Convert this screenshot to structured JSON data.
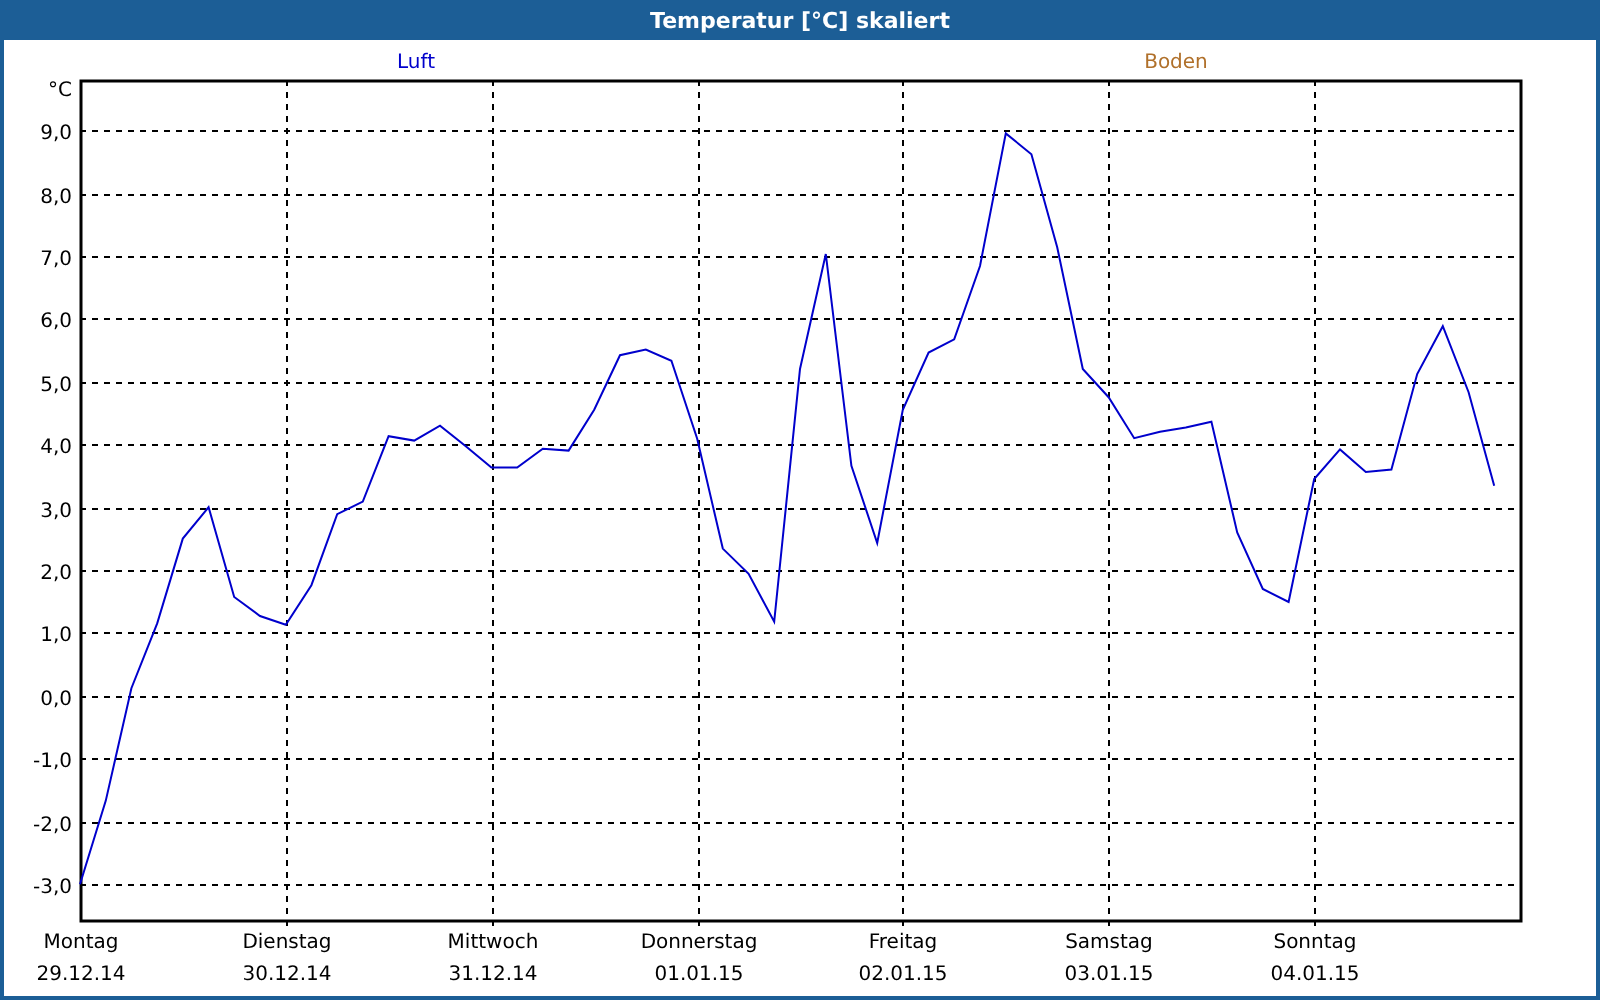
{
  "chart": {
    "extra_legend": [
      {
        "label": "Boden",
        "color": "#b0702a"
      }
    ],
    "dates": [
      "29.12.14",
      "30.12.14",
      "31.12.14",
      "01.01.15",
      "02.01.15",
      "03.01.15",
      "04.01.15"
    ],
    "chart_data": {
      "type": "line",
      "title": "Temperatur [°C] skaliert",
      "ylabel": "°C",
      "grid": true,
      "ylim": [
        -3.57,
        9.8
      ],
      "yticks": [
        {
          "value": 9,
          "label": "9,0"
        },
        {
          "value": 8,
          "label": "8,0"
        },
        {
          "value": 7,
          "label": "7,0"
        },
        {
          "value": 6,
          "label": "6,0"
        },
        {
          "value": 5,
          "label": "5,0"
        },
        {
          "value": 4,
          "label": "4,0"
        },
        {
          "value": 3,
          "label": "3,0"
        },
        {
          "value": 2,
          "label": "2,0"
        },
        {
          "value": 1,
          "label": "1,0"
        },
        {
          "value": 0,
          "label": "0,0"
        },
        {
          "value": -1,
          "label": "-1,0"
        },
        {
          "value": -2,
          "label": "-2,0"
        },
        {
          "value": -3,
          "label": "-3,0"
        }
      ],
      "categories": [
        "Montag",
        null,
        null,
        null,
        null,
        null,
        null,
        null,
        "Dienstag",
        null,
        null,
        null,
        null,
        null,
        null,
        null,
        "Mittwoch",
        null,
        null,
        null,
        null,
        null,
        null,
        null,
        "Donnerstag",
        null,
        null,
        null,
        null,
        null,
        null,
        null,
        "Freitag",
        null,
        null,
        null,
        null,
        null,
        null,
        null,
        "Samstag",
        null,
        null,
        null,
        null,
        null,
        null,
        null,
        "Sonntag",
        null,
        null,
        null,
        null,
        null,
        null,
        null
      ],
      "series": [
        {
          "name": "Luft",
          "color": "#0000cc",
          "values": [
            -3,
            -1.67,
            0.12,
            1.15,
            2.5,
            3.0,
            1.57,
            1.27,
            1.13,
            1.76,
            2.89,
            3.09,
            4.13,
            4.06,
            4.3,
            3.97,
            3.63,
            3.63,
            3.93,
            3.9,
            4.55,
            5.42,
            5.51,
            5.33,
            4.09,
            2.34,
            1.94,
            1.18,
            5.2,
            7.03,
            3.66,
            2.43,
            4.55,
            5.46,
            5.67,
            6.84,
            8.95,
            8.62,
            7.14,
            5.2,
            4.75,
            4.1,
            4.2,
            4.27,
            4.36,
            2.6,
            1.7,
            1.49,
            3.45,
            3.92,
            3.56,
            3.6,
            5.12,
            5.88,
            4.83,
            3.34
          ]
        }
      ]
    }
  }
}
